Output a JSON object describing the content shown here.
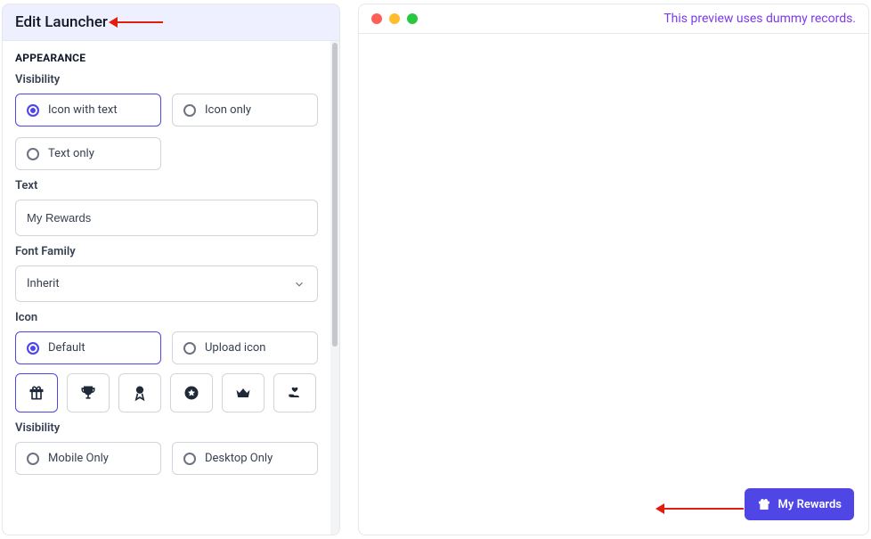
{
  "left": {
    "title": "Edit Launcher",
    "appearance_heading": "APPEARANCE",
    "visibility_label": "Visibility",
    "vis_options": {
      "icon_text": "Icon with text",
      "icon_only": "Icon only",
      "text_only": "Text only"
    },
    "text_label": "Text",
    "text_value": "My Rewards",
    "font_label": "Font Family",
    "font_value": "Inherit",
    "icon_label": "Icon",
    "icon_options": {
      "default": "Default",
      "upload": "Upload icon"
    },
    "icon_names": [
      "gift-icon",
      "trophy-icon",
      "medal-icon",
      "star-circle-icon",
      "crown-icon",
      "hand-heart-icon"
    ],
    "visibility2_label": "Visibility",
    "vis2_options": {
      "mobile": "Mobile Only",
      "desktop": "Desktop Only"
    }
  },
  "right": {
    "preview_note": "This preview uses dummy records.",
    "launcher_label": "My Rewards"
  }
}
